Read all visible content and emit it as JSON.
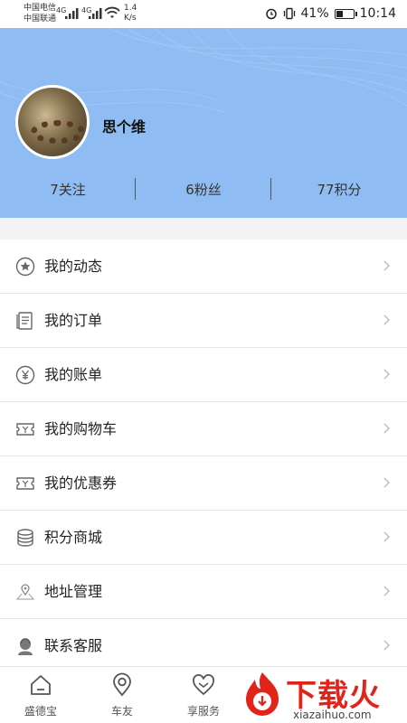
{
  "status_bar": {
    "carrier_1": "中国电信",
    "carrier_2": "中国联通",
    "net_1": "4G",
    "net_2": "4G",
    "speed_value": "1.4",
    "speed_unit": "K/s",
    "battery_percent": "41%",
    "battery_level": 0.41,
    "time": "10:14"
  },
  "profile": {
    "username": "思个维",
    "stats": [
      {
        "label": "7关注"
      },
      {
        "label": "6粉丝"
      },
      {
        "label": "77积分"
      }
    ]
  },
  "menu": [
    {
      "label": "我的动态",
      "icon": "star-circle-icon"
    },
    {
      "label": "我的订单",
      "icon": "order-receipt-icon"
    },
    {
      "label": "我的账单",
      "icon": "yen-circle-icon"
    },
    {
      "label": "我的购物车",
      "icon": "ticket-icon"
    },
    {
      "label": "我的优惠券",
      "icon": "coupon-icon"
    },
    {
      "label": "积分商城",
      "icon": "coins-stack-icon"
    },
    {
      "label": "地址管理",
      "icon": "map-pin-icon"
    },
    {
      "label": "联系客服",
      "icon": "support-agent-icon"
    }
  ],
  "tabbar": [
    {
      "label": "盛德宝",
      "icon": "home-icon"
    },
    {
      "label": "车友",
      "icon": "location-pin-icon"
    },
    {
      "label": "享服务",
      "icon": "heart-icon"
    }
  ],
  "watermark": {
    "title": "下载火",
    "url": "xiazaihuo.com"
  },
  "colors": {
    "header_bg": "#8fbdf3",
    "watermark_red": "#e2231a"
  }
}
